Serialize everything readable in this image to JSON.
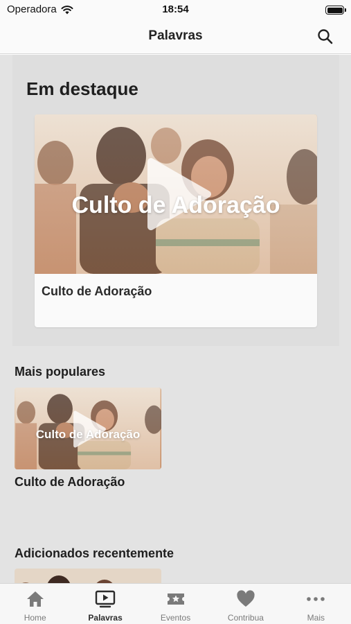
{
  "status_bar": {
    "carrier": "Operadora",
    "time": "18:54",
    "icons": [
      "wifi-icon",
      "battery-icon"
    ]
  },
  "nav": {
    "title": "Palavras",
    "search_icon": "search-icon"
  },
  "featured": {
    "section_title": "Em destaque",
    "card": {
      "thumbnail_title": "Culto de Adoração",
      "label": "Culto de Adoração",
      "icon": "play-icon"
    }
  },
  "popular": {
    "section_title": "Mais populares",
    "items": [
      {
        "thumbnail_title": "Culto de Adoração",
        "label": "Culto de Adoração",
        "icon": "play-icon"
      }
    ]
  },
  "recent": {
    "section_title": "Adicionados recentemente"
  },
  "tabs": [
    {
      "label": "Home",
      "icon": "home-icon",
      "active": false
    },
    {
      "label": "Palavras",
      "icon": "video-play-icon",
      "active": true
    },
    {
      "label": "Eventos",
      "icon": "ticket-star-icon",
      "active": false
    },
    {
      "label": "Contribua",
      "icon": "heart-icon",
      "active": false
    },
    {
      "label": "Mais",
      "icon": "more-dots-icon",
      "active": false
    }
  ],
  "colors": {
    "background": "#e3e3e3",
    "bar": "#fafafa",
    "active_tab": "#2b2b2b",
    "inactive_tab": "#7a7a7a",
    "thumbnail_tone": "#c9946b"
  }
}
